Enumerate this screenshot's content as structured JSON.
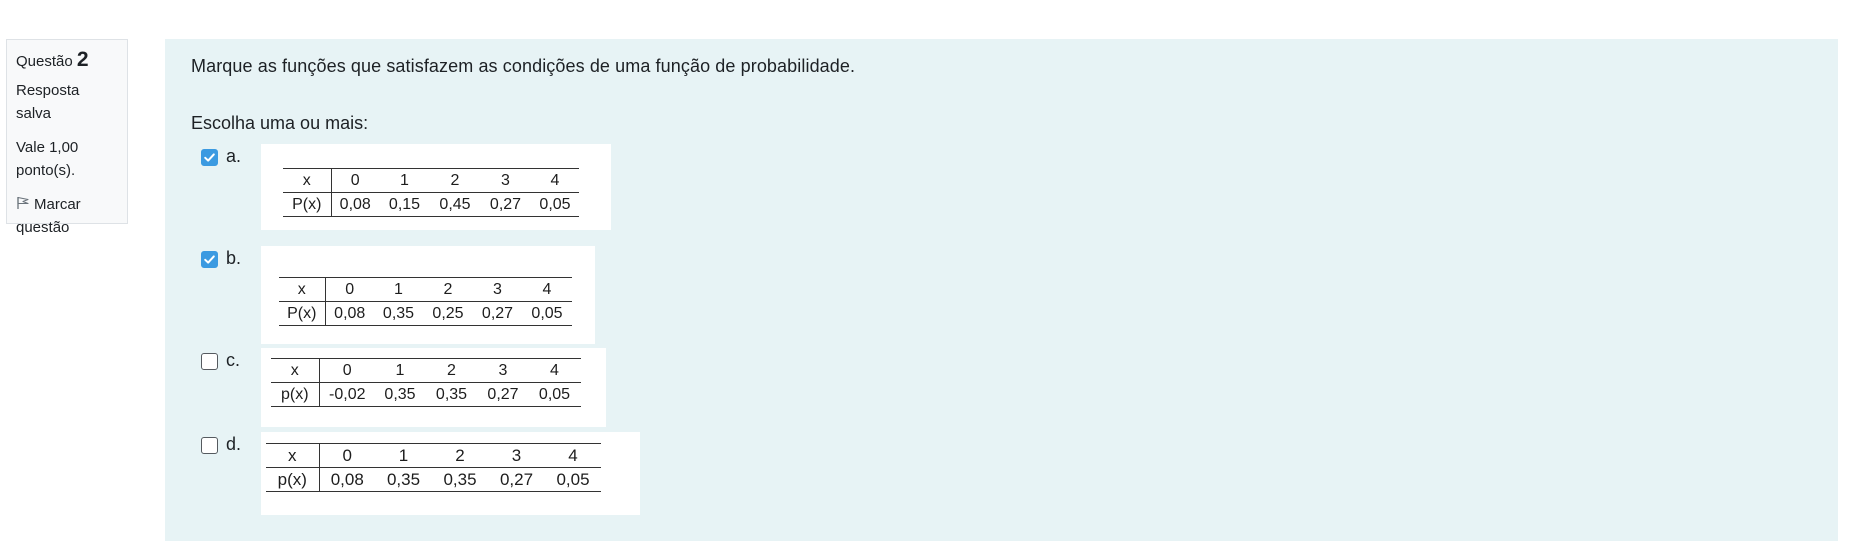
{
  "info": {
    "question_label": "Questão",
    "question_number": "2",
    "status": "Resposta salva",
    "grade": "Vale 1,00 ponto(s).",
    "flag_label": "Marcar questão",
    "flag_icon": "flag-icon"
  },
  "question": {
    "text": "Marque as funções que satisfazem as condições de uma função de probabilidade.",
    "prompt": "Escolha uma ou mais:"
  },
  "colors": {
    "content_bg": "#e7f3f5",
    "checkbox_checked": "#3b9ae1"
  },
  "options": [
    {
      "letter": "a.",
      "checked": true,
      "table": {
        "header_label": "x",
        "row_label": "P(x)",
        "x": [
          "0",
          "1",
          "2",
          "3",
          "4"
        ],
        "p": [
          "0,08",
          "0,15",
          "0,45",
          "0,27",
          "0,05"
        ]
      }
    },
    {
      "letter": "b.",
      "checked": true,
      "table": {
        "header_label": "x",
        "row_label": "P(x)",
        "x": [
          "0",
          "1",
          "2",
          "3",
          "4"
        ],
        "p": [
          "0,08",
          "0,35",
          "0,25",
          "0,27",
          "0,05"
        ]
      }
    },
    {
      "letter": "c.",
      "checked": false,
      "table": {
        "header_label": "x",
        "row_label": "p(x)",
        "x": [
          "0",
          "1",
          "2",
          "3",
          "4"
        ],
        "p": [
          "-0,02",
          "0,35",
          "0,35",
          "0,27",
          "0,05"
        ]
      }
    },
    {
      "letter": "d.",
      "checked": false,
      "table": {
        "header_label": "x",
        "row_label": "p(x)",
        "x": [
          "0",
          "1",
          "2",
          "3",
          "4"
        ],
        "p": [
          "0,08",
          "0,35",
          "0,35",
          "0,27",
          "0,05"
        ]
      }
    }
  ]
}
